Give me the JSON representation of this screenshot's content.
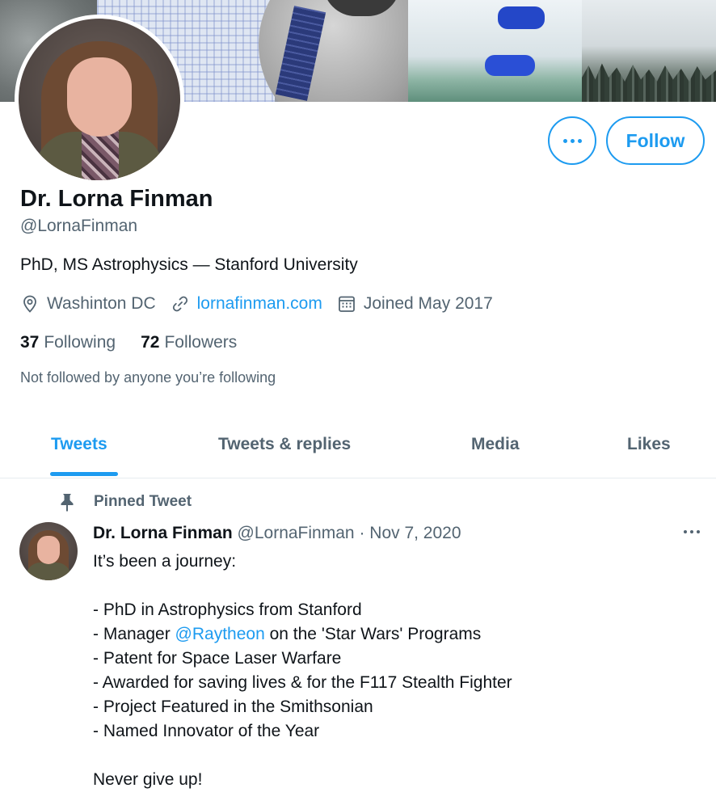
{
  "profile": {
    "name": "Dr. Lorna Finman",
    "handle": "@LornaFinman",
    "bio": "PhD, MS Astrophysics — Stanford University",
    "location": "Washinton DC",
    "website": "lornafinman.com",
    "joined": "Joined May 2017",
    "following_count": "37",
    "following_label": "Following",
    "followers_count": "72",
    "followers_label": "Followers",
    "not_followed_text": "Not followed by anyone you’re following"
  },
  "actions": {
    "follow_label": "Follow",
    "more_icon": "more-horizontal-icon"
  },
  "tabs": [
    {
      "label": "Tweets",
      "active": true
    },
    {
      "label": "Tweets & replies",
      "active": false
    },
    {
      "label": "Media",
      "active": false
    },
    {
      "label": "Likes",
      "active": false
    }
  ],
  "pinned_tweet": {
    "pinned_label": "Pinned Tweet",
    "author_name": "Dr. Lorna Finman",
    "author_handle": "@LornaFinman",
    "separator": "·",
    "date": "Nov 7, 2020",
    "lines": {
      "l1": "It’s been a journey:",
      "l2": "- PhD in Astrophysics from Stanford",
      "l3_prefix": "- Manager ",
      "l3_mention": "@Raytheon",
      "l3_suffix": " on the 'Star Wars' Programs",
      "l4": "- Patent for Space Laser Warfare",
      "l5": "- Awarded for saving lives & for the F117 Stealth Fighter",
      "l6": "- Project Featured in the Smithsonian",
      "l7": "- Named Innovator of the Year",
      "l8": "Never give up!"
    }
  },
  "colors": {
    "accent": "#1d9bf0",
    "text_primary": "#0f1419",
    "text_secondary": "#536471",
    "divider": "#e6ecf0"
  }
}
